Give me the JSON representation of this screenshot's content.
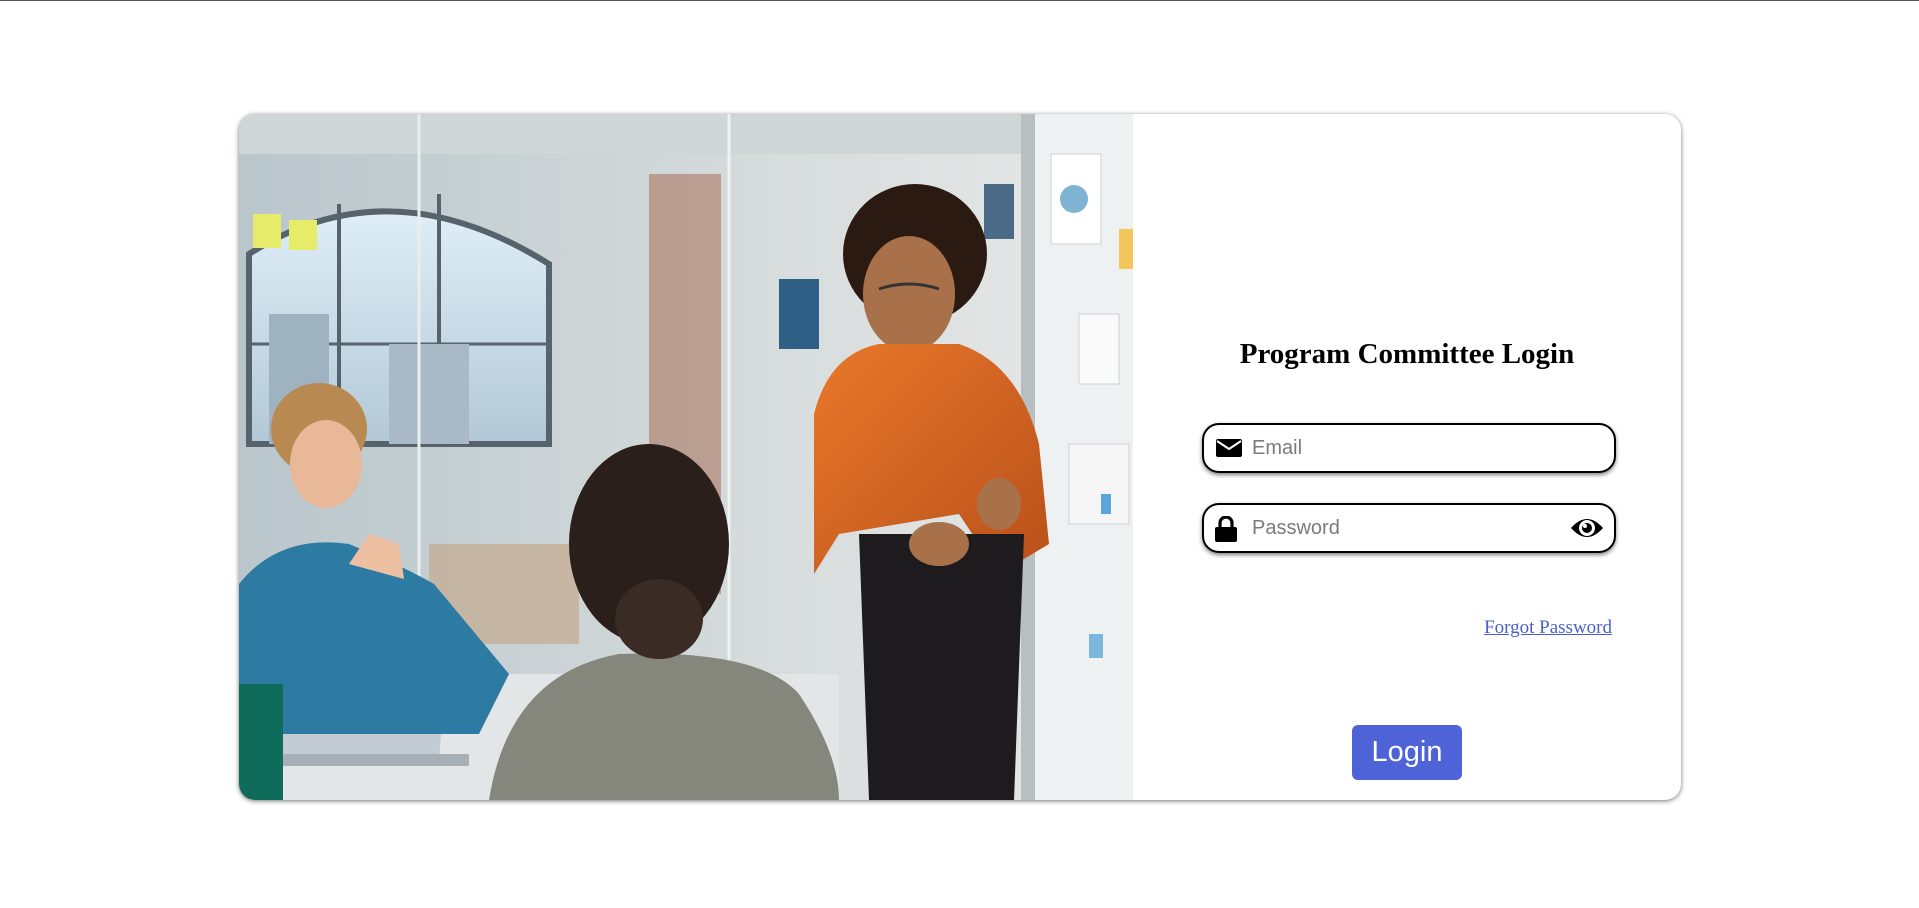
{
  "page": {
    "title": "Program Committee Login"
  },
  "hero": {
    "image": "team-meeting-photo"
  },
  "form": {
    "email": {
      "placeholder": "Email",
      "value": "",
      "icon": "envelope-icon"
    },
    "password": {
      "placeholder": "Password",
      "value": "",
      "icon": "lock-icon",
      "toggle_icon": "eye-icon"
    },
    "forgot_label": "Forgot Password",
    "login_label": "Login"
  },
  "colors": {
    "accent": "#4f63d9",
    "link": "#4a5fcf",
    "border": "#000000"
  }
}
